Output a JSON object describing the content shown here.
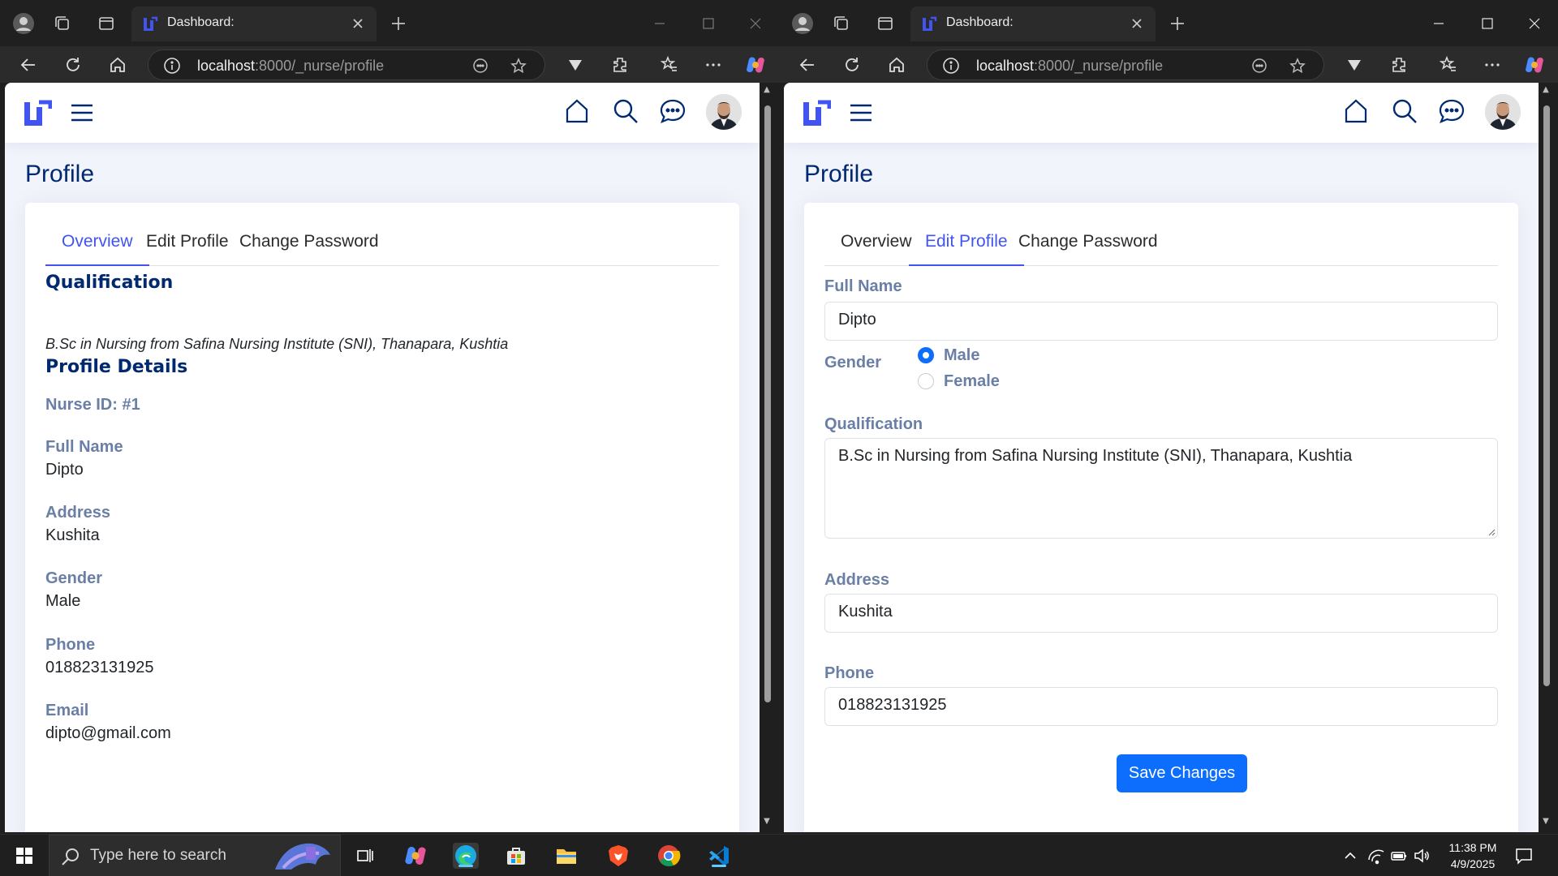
{
  "browser": {
    "tab_title": "Dashboard:",
    "url_host": "localhost",
    "url_rest": ":8000/_nurse/profile"
  },
  "page": {
    "title": "Profile",
    "tabs": [
      "Overview",
      "Edit Profile",
      "Change Password"
    ]
  },
  "overview": {
    "qualification_heading": "Qualification",
    "qualification_text": "B.Sc in Nursing from Safina Nursing Institute (SNI), Thanapara, Kushtia",
    "details_heading": "Profile Details",
    "nurse_id": "Nurse ID: #1",
    "fields": [
      {
        "label": "Full Name",
        "value": "Dipto"
      },
      {
        "label": "Address",
        "value": "Kushita"
      },
      {
        "label": "Gender",
        "value": "Male"
      },
      {
        "label": "Phone",
        "value": "018823131925"
      },
      {
        "label": "Email",
        "value": "dipto@gmail.com"
      }
    ]
  },
  "edit": {
    "full_name_label": "Full Name",
    "full_name_value": "Dipto",
    "gender_label": "Gender",
    "gender_options": [
      "Male",
      "Female"
    ],
    "gender_selected": "Male",
    "qualification_label": "Qualification",
    "qualification_value": "B.Sc in Nursing from Safina Nursing Institute (SNI), Thanapara, Kushtia",
    "address_label": "Address",
    "address_value": "Kushita",
    "phone_label": "Phone",
    "phone_value": "018823131925",
    "save_label": "Save Changes"
  },
  "taskbar": {
    "search_placeholder": "Type here to search",
    "time": "11:38 PM",
    "date": "4/9/2025"
  },
  "colors": {
    "accent": "#4154f1",
    "heading": "#012970",
    "label": "#6a7fa6",
    "primary_button": "#0d6efd",
    "page_bg": "#f1f4fa"
  }
}
